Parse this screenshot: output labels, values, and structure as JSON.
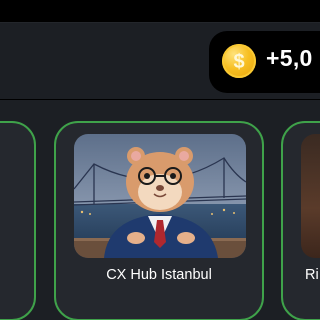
{
  "header": {
    "balance": "+5,0",
    "coin_icon": "coin-icon"
  },
  "cards": [
    {
      "id": "left",
      "title": ""
    },
    {
      "id": "center",
      "title": "CX Hub Istanbul",
      "image": "hamster-ceo-istanbul-image"
    },
    {
      "id": "right",
      "title": "Ri"
    }
  ],
  "colors": {
    "background": "#000000",
    "panel": "#1c1f24",
    "card": "#25282e",
    "card_border": "#3fa24a",
    "coin": "#f7bf22"
  }
}
